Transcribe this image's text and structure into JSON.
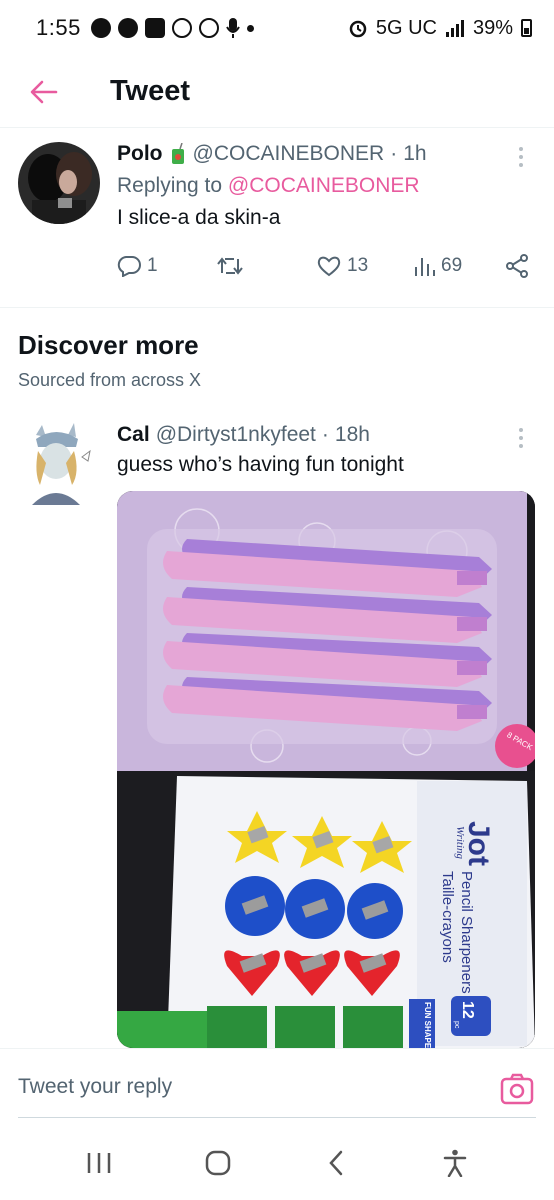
{
  "status_bar": {
    "time": "1:55",
    "network": "5G UC",
    "battery": "39%"
  },
  "header": {
    "title": "Tweet"
  },
  "reply_tweet": {
    "name": "Polo",
    "handle": "@COCAINEBONER",
    "separator": "·",
    "time": "1h",
    "replying_prefix": "Replying to",
    "replying_handle": "@COCAINEBONER",
    "text": "I slice-a da skin-a",
    "stats": {
      "replies": "1",
      "retweets": "",
      "likes": "13",
      "views": "69"
    }
  },
  "discover": {
    "title": "Discover more",
    "subtitle": "Sourced from across X"
  },
  "suggested_tweet": {
    "name": "Cal",
    "handle": "@Dirtyst1nkyfeet",
    "separator": "·",
    "time": "18h",
    "text": "guess who’s having fun tonight",
    "media": {
      "top_package_badge": "8 PACK",
      "bottom_brand": "Jot",
      "bottom_brand_sub": "Writing",
      "bottom_title_en": "Pencil Sharpeners",
      "bottom_title_fr": "Taille-crayons",
      "bottom_count": "12",
      "bottom_count_unit": "pc",
      "bottom_badge": "FUN SHAPES"
    }
  },
  "reply_bar": {
    "placeholder": "Tweet your reply"
  },
  "colors": {
    "accent": "#e85b9e",
    "text_primary": "#0f1419",
    "text_secondary": "#536471"
  }
}
